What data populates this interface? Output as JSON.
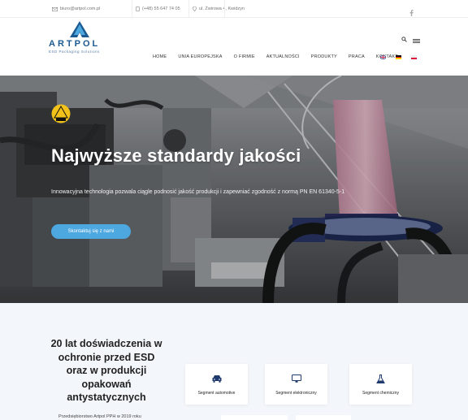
{
  "topbar": {
    "email": "biuro@artpol.com.pl",
    "phone": "(+48) 55 647 74 05",
    "address": "ul. Żwirowa 4, Kwidzyn",
    "icons": [
      "mail-icon",
      "phone-icon",
      "location-icon",
      "facebook-icon"
    ]
  },
  "logo": {
    "name": "ARTPOL",
    "tagline": "ESD Packaging Solutions"
  },
  "nav": {
    "items": [
      "Home",
      "Unia Europejska",
      "O firmie",
      "Aktualności",
      "Produkty",
      "Praca",
      "Kontakt"
    ],
    "languages": [
      "en",
      "de",
      "pl"
    ]
  },
  "hero": {
    "title": "Najwyższe standardy jakości",
    "subtitle": "Innowacyjna technologia pozwala ciągle podnosić jakość produkcji i zapewniać zgodność z normą PN EN 61340-5-1",
    "button": "Skontaktuj się z nami",
    "badge": "ESD"
  },
  "section": {
    "title": "20 lat doświadczenia w ochronie przed ESD oraz w produkcji opakowań antystatycznych",
    "text": "Przedsiębiorstwo Artpol PPH w 2019 roku",
    "cards": [
      {
        "label": "Segment automotive",
        "icon": "car-icon"
      },
      {
        "label": "Segment elektroniczny",
        "icon": "monitor-icon"
      },
      {
        "label": "Segment chemiczny",
        "icon": "flask-icon"
      }
    ]
  },
  "colors": {
    "brand": "#1c5a91",
    "accent": "#4ea8e0",
    "section_bg": "#f3f6fa"
  }
}
